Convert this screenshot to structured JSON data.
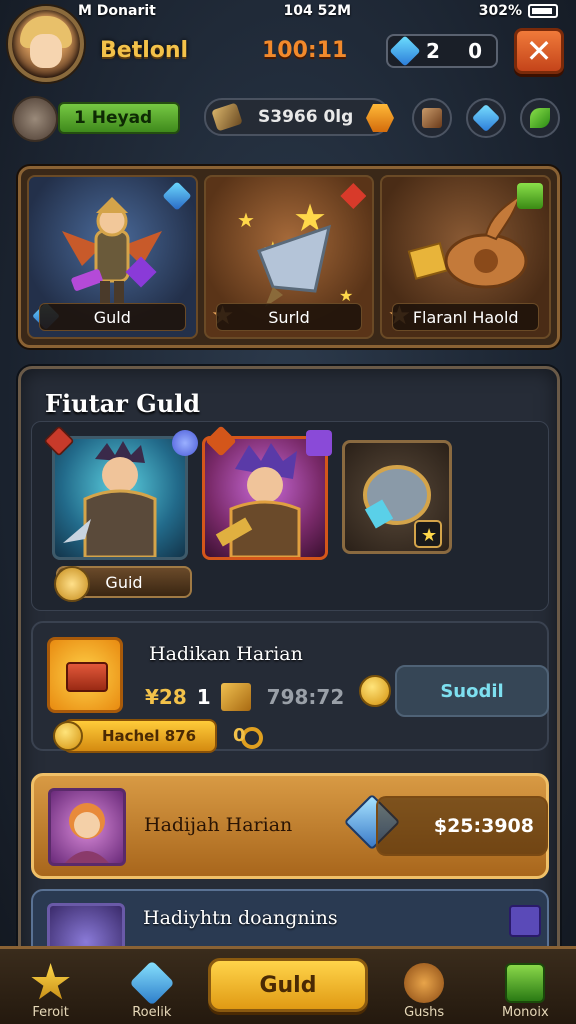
{
  "status_bar": {
    "carrier": "M Donarit",
    "time": "104 52M",
    "battery": "302%"
  },
  "header": {
    "player_name": "Betlonl",
    "timer": "100:11",
    "gems": "2",
    "gems_secondary": "0",
    "close_label": "✕"
  },
  "resources": {
    "level_label": "1 Heyad",
    "gold": "S3966 0lg"
  },
  "featured": [
    {
      "label": "Guld"
    },
    {
      "label": "Surld"
    },
    {
      "label": "Flaranl Haold"
    }
  ],
  "guild": {
    "title": "Fiutar Guld",
    "hero_label": "Guid"
  },
  "reward_daily": {
    "title": "Hadikan Harian",
    "price": "¥28",
    "qty": "1",
    "crossed_price": "798:72",
    "button": "Suodil",
    "pill": "Hachel 876",
    "extra": "0"
  },
  "reward_hadijah": {
    "title": "Hadijah Harian",
    "price": "$25:3908"
  },
  "reward_third": {
    "title": "Hadiyhtn doangnins"
  },
  "bottom_nav": {
    "item1": "Feroit",
    "item2": "Roelik",
    "center": "Guld",
    "item4": "Gushs",
    "item5": "Monoix"
  },
  "colors": {
    "gold_text": "#f3c24a",
    "timer": "#f28a2c",
    "close_button": "#e0602a",
    "panel": "#262c37",
    "highlight_card": "#d89a44"
  }
}
